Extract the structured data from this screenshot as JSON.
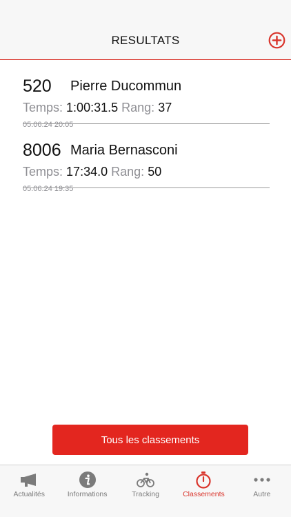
{
  "header": {
    "title": "RESULTATS",
    "add_icon": "plus-circle-icon"
  },
  "results": [
    {
      "bib": "520",
      "name": "Pierre Ducommun",
      "time_label": "Temps:",
      "time": "1:00:31.5",
      "rank_label": "Rang:",
      "rank": "37",
      "date": "05.06.24 20:05"
    },
    {
      "bib": "8006",
      "name": "Maria Bernasconi",
      "time_label": "Temps:",
      "time": "17:34.0",
      "rank_label": "Rang:",
      "rank": "50",
      "date": "05.06.24 19:35"
    }
  ],
  "primary_button": {
    "label": "Tous les classements"
  },
  "tabbar": {
    "items": [
      {
        "label": "Actualités",
        "icon": "megaphone-icon",
        "active": false
      },
      {
        "label": "Informations",
        "icon": "info-icon",
        "active": false
      },
      {
        "label": "Tracking",
        "icon": "bicycle-icon",
        "active": false
      },
      {
        "label": "Classements",
        "icon": "stopwatch-icon",
        "active": true
      },
      {
        "label": "Autre",
        "icon": "more-icon",
        "active": false
      }
    ]
  },
  "colors": {
    "accent": "#e3261f",
    "header_bg": "#f7f7f7",
    "muted": "#8e8e93",
    "tab_inactive": "#7b7b7b"
  }
}
